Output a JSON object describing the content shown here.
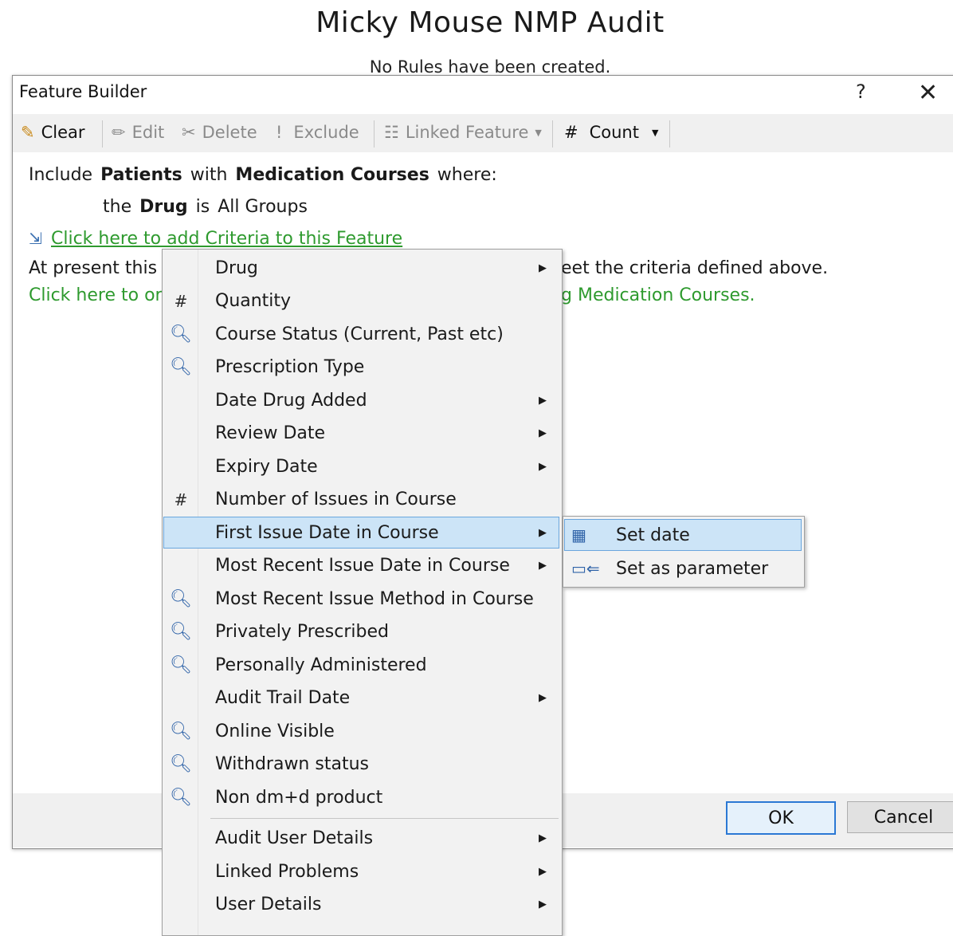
{
  "page": {
    "title": "Micky Mouse NMP Audit",
    "subtitle": "No Rules have been created."
  },
  "dialog": {
    "title": "Feature Builder",
    "help": "?",
    "close": "✕"
  },
  "toolbar": {
    "clear": "Clear",
    "edit": "Edit",
    "delete": "Delete",
    "exclude": "Exclude",
    "linked_feature": "Linked Feature",
    "count": "Count"
  },
  "content": {
    "include": "Include",
    "patients": "Patients",
    "with": "with",
    "medication_courses": "Medication Courses",
    "where": "where:",
    "the": "the",
    "drug": "Drug",
    "is": "is",
    "all_groups": "All Groups",
    "add_criteria_link": "Click here to add Criteria to this Feature",
    "present_left": "At present this fe",
    "present_right": "eet the criteria defined above.",
    "order_left": "Click here to ord",
    "order_right": "g Medication Courses."
  },
  "footer": {
    "ok": "OK",
    "cancel": "Cancel"
  },
  "menu": {
    "items": [
      {
        "label": "Drug",
        "icon": "",
        "submenu": true
      },
      {
        "label": "Quantity",
        "icon": "#",
        "submenu": false
      },
      {
        "label": "Course Status (Current, Past etc)",
        "icon": "magnifier",
        "submenu": false
      },
      {
        "label": "Prescription Type",
        "icon": "magnifier",
        "submenu": false
      },
      {
        "label": "Date Drug Added",
        "icon": "",
        "submenu": true
      },
      {
        "label": "Review Date",
        "icon": "",
        "submenu": true
      },
      {
        "label": "Expiry Date",
        "icon": "",
        "submenu": true
      },
      {
        "label": "Number of Issues in Course",
        "icon": "#",
        "submenu": false
      },
      {
        "label": "First Issue Date in Course",
        "icon": "",
        "submenu": true,
        "selected": true
      },
      {
        "label": "Most Recent Issue Date in Course",
        "icon": "",
        "submenu": true
      },
      {
        "label": "Most Recent Issue Method in Course",
        "icon": "magnifier",
        "submenu": false
      },
      {
        "label": "Privately Prescribed",
        "icon": "magnifier",
        "submenu": false
      },
      {
        "label": "Personally Administered",
        "icon": "magnifier",
        "submenu": false
      },
      {
        "label": "Audit Trail Date",
        "icon": "",
        "submenu": true
      },
      {
        "label": "Online Visible",
        "icon": "magnifier",
        "submenu": false
      },
      {
        "label": "Withdrawn status",
        "icon": "magnifier",
        "submenu": false
      },
      {
        "label": "Non dm+d product",
        "icon": "magnifier",
        "submenu": false
      },
      {
        "label": "Audit User Details",
        "icon": "",
        "submenu": true
      },
      {
        "label": "Linked Problems",
        "icon": "",
        "submenu": true
      },
      {
        "label": "User Details",
        "icon": "",
        "submenu": true
      }
    ]
  },
  "submenu": {
    "items": [
      {
        "label": "Set date",
        "icon": "calendar-icon",
        "selected": true
      },
      {
        "label": "Set as parameter",
        "icon": "parameter-icon",
        "selected": false
      }
    ]
  }
}
